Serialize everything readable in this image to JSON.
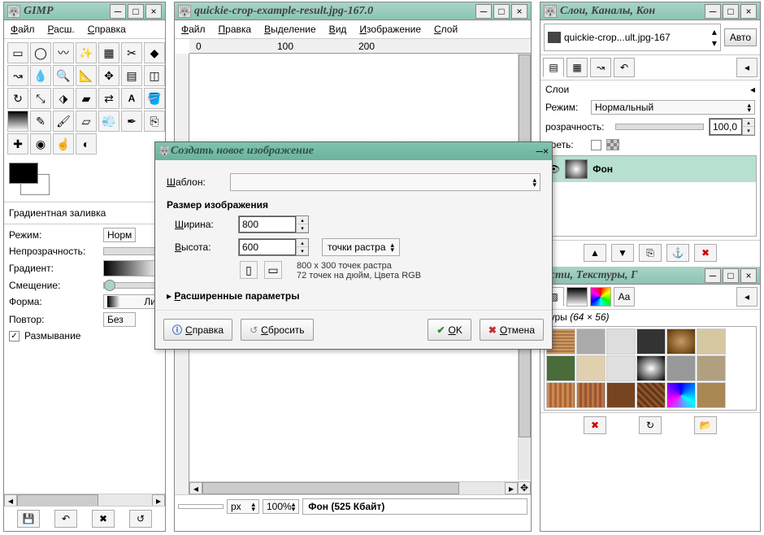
{
  "toolbox": {
    "title": "GIMP",
    "menus": [
      "Файл",
      "Расш.",
      "Справка"
    ],
    "tools": [
      "rect-select",
      "ellipse-select",
      "lasso",
      "wand",
      "by-color",
      "scissors",
      "fg-select",
      "paths",
      "color-picker",
      "zoom",
      "measure",
      "move",
      "align",
      "crop",
      "rotate",
      "scale",
      "shear",
      "perspective",
      "flip",
      "text",
      "bucket",
      "gradient",
      "pencil",
      "brush",
      "eraser",
      "airbrush",
      "ink",
      "clone",
      "heal",
      "blur",
      "smudge",
      "dodge"
    ],
    "option_title": "Градиентная заливка",
    "mode_label": "Режим:",
    "mode_value": "Норм",
    "opacity_label": "Непрозрачность:",
    "gradient_label": "Градиент:",
    "offset_label": "Смещение:",
    "shape_label": "Форма:",
    "shape_value": "Ли",
    "repeat_label": "Повтор:",
    "repeat_value": "Без",
    "dither_label": "Размывание"
  },
  "imagewin": {
    "title": "quickie-crop-example-result.jpg-167.0",
    "menus": [
      "Файл",
      "Правка",
      "Выделение",
      "Вид",
      "Изображение",
      "Слой"
    ],
    "ruler_marks": [
      "0",
      "100",
      "200"
    ],
    "status_unit": "px",
    "status_zoom": "100%",
    "status_layer": "Фон (525 Кбайт)"
  },
  "dialog": {
    "title": "Создать новое изображение",
    "template_label": "Шаблон:",
    "size_heading": "Размер изображения",
    "width_label": "Ширина:",
    "width_value": "800",
    "height_label": "Высота:",
    "height_value": "600",
    "unit_label": "точки растра",
    "info1": "800 x 300 точек растра",
    "info2": "72 точек на дюйм, Цвета RGB",
    "advanced_label": "Расширенные параметры",
    "btn_help": "Справка",
    "btn_reset": "Сбросить",
    "btn_ok": "OK",
    "btn_cancel": "Отмена"
  },
  "layers": {
    "title": "Слои, Каналы, Кон",
    "picker": "quickie-crop...ult.jpg-167",
    "auto": "Авто",
    "panel_label": "Слои",
    "mode_label": "Режим:",
    "mode_value": "Нормальный",
    "opacity_label": "розрачность:",
    "opacity_value": "100,0",
    "lock_label": "ереть:",
    "layer_name": "Фон",
    "brushes_title": "исти, Текстуры, Г",
    "textures_label": "туры",
    "textures_size": "(64 × 56)"
  }
}
